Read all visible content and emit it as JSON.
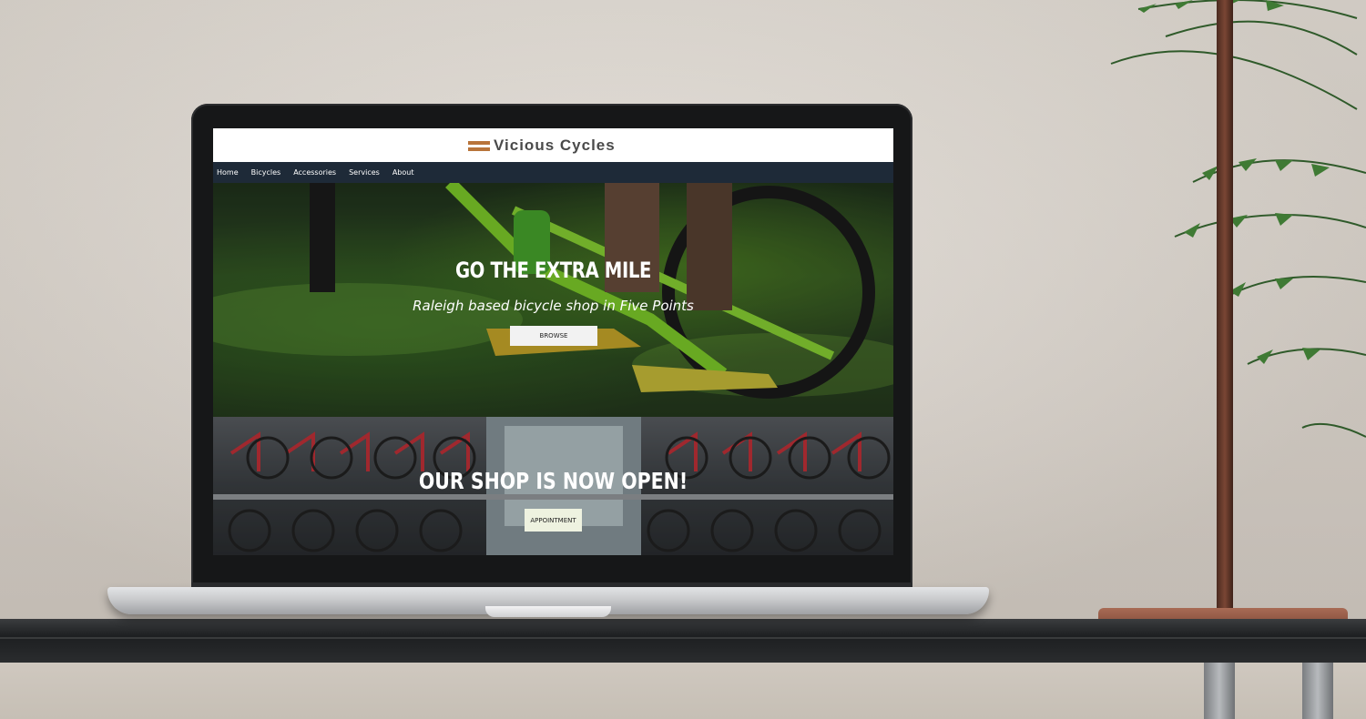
{
  "site": {
    "logo_text": "Vicious Cycles",
    "logo_color": "#b8743a",
    "nav": [
      {
        "label": "Home"
      },
      {
        "label": "Bicycles"
      },
      {
        "label": "Accessories"
      },
      {
        "label": "Services"
      },
      {
        "label": "About"
      }
    ],
    "nav_bg": "#1e2a38"
  },
  "hero": {
    "title": "GO THE EXTRA MILE",
    "subtitle": "Raleigh based bicycle shop in Five Points",
    "button_label": "BROWSE"
  },
  "shop": {
    "title": "OUR SHOP IS NOW OPEN!",
    "button_label": "APPOINTMENT"
  },
  "icons": {
    "logo_mark": "double-bar-logo-icon"
  }
}
